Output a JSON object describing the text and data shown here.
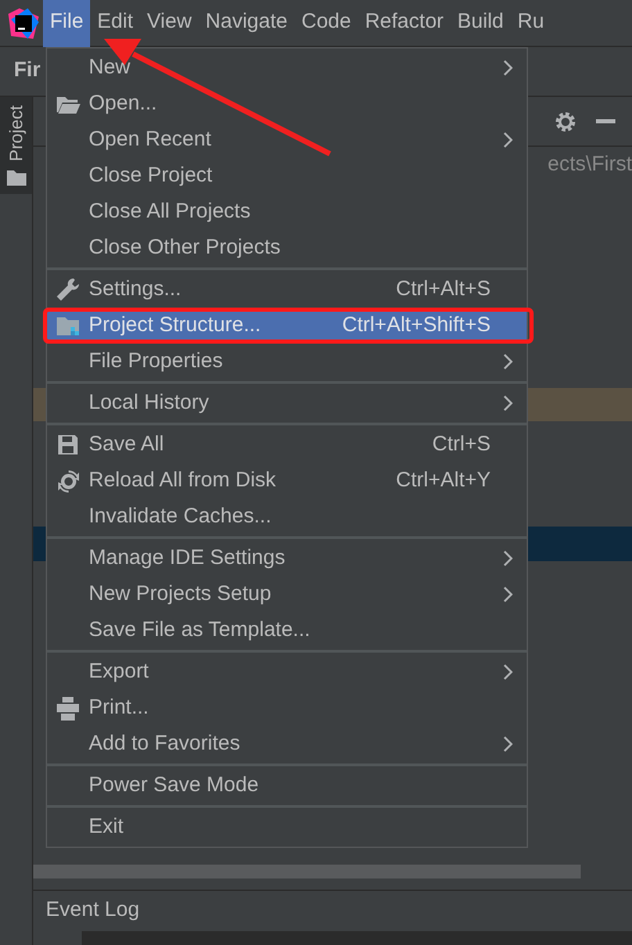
{
  "menu_bar": {
    "items": [
      {
        "label": "File",
        "selected": true
      },
      {
        "label": "Edit",
        "selected": false
      },
      {
        "label": "View",
        "selected": false
      },
      {
        "label": "Navigate",
        "selected": false
      },
      {
        "label": "Code",
        "selected": false
      },
      {
        "label": "Refactor",
        "selected": false
      },
      {
        "label": "Build",
        "selected": false
      },
      {
        "label": "Ru",
        "selected": false
      }
    ]
  },
  "toolbar": {
    "title": "Fir"
  },
  "side_tab": {
    "label": "Project"
  },
  "project_panel": {
    "path": "ects\\First"
  },
  "file_menu": {
    "groups": [
      [
        {
          "label": "New",
          "submenu": true,
          "kind": "plain",
          "selected": false,
          "outlined": false
        },
        {
          "label": "Open...",
          "submenu": false,
          "kind": "folder",
          "selected": false,
          "outlined": false
        },
        {
          "label": "Open Recent",
          "submenu": true,
          "kind": "plain",
          "selected": false,
          "outlined": false
        },
        {
          "label": "Close Project",
          "submenu": false,
          "kind": "plain",
          "selected": false,
          "outlined": false
        },
        {
          "label": "Close All Projects",
          "submenu": false,
          "kind": "plain",
          "selected": false,
          "outlined": false
        },
        {
          "label": "Close Other Projects",
          "submenu": false,
          "kind": "plain",
          "selected": false,
          "outlined": false
        }
      ],
      [
        {
          "label": "Settings...",
          "shortcut": "Ctrl+Alt+S",
          "submenu": false,
          "kind": "wrench",
          "selected": false,
          "outlined": false
        },
        {
          "label": "Project Structure...",
          "shortcut": "Ctrl+Alt+Shift+S",
          "submenu": false,
          "kind": "structure",
          "selected": true,
          "outlined": true
        },
        {
          "label": "File Properties",
          "submenu": true,
          "kind": "plain",
          "selected": false,
          "outlined": false
        }
      ],
      [
        {
          "label": "Local History",
          "submenu": true,
          "kind": "plain",
          "selected": false,
          "outlined": false
        }
      ],
      [
        {
          "label": "Save All",
          "shortcut": "Ctrl+S",
          "submenu": false,
          "kind": "save",
          "selected": false,
          "outlined": false
        },
        {
          "label": "Reload All from Disk",
          "shortcut": "Ctrl+Alt+Y",
          "submenu": false,
          "kind": "reload",
          "selected": false,
          "outlined": false
        },
        {
          "label": "Invalidate Caches...",
          "submenu": false,
          "kind": "plain",
          "selected": false,
          "outlined": false
        }
      ],
      [
        {
          "label": "Manage IDE Settings",
          "submenu": true,
          "kind": "plain",
          "selected": false,
          "outlined": false
        },
        {
          "label": "New Projects Setup",
          "submenu": true,
          "kind": "plain",
          "selected": false,
          "outlined": false
        },
        {
          "label": "Save File as Template...",
          "submenu": false,
          "kind": "plain",
          "selected": false,
          "outlined": false
        }
      ],
      [
        {
          "label": "Export",
          "submenu": true,
          "kind": "plain",
          "selected": false,
          "outlined": false
        },
        {
          "label": "Print...",
          "submenu": false,
          "kind": "printer",
          "selected": false,
          "outlined": false
        },
        {
          "label": "Add to Favorites",
          "submenu": true,
          "kind": "plain",
          "selected": false,
          "outlined": false
        }
      ],
      [
        {
          "label": "Power Save Mode",
          "submenu": false,
          "kind": "plain",
          "selected": false,
          "outlined": false
        }
      ],
      [
        {
          "label": "Exit",
          "submenu": false,
          "kind": "plain",
          "selected": false,
          "outlined": false
        }
      ]
    ]
  },
  "annotation_arrow": true,
  "event_log": {
    "title": "Event Log"
  }
}
